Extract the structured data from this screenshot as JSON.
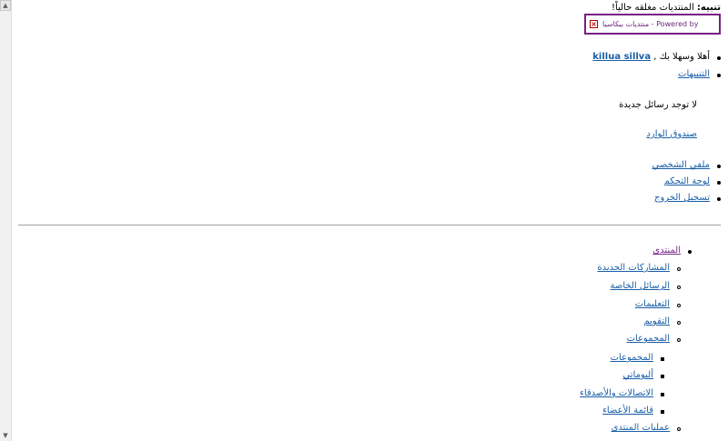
{
  "notice": {
    "label": "تنبيه:",
    "text": "المنتديات مغلقه حالياً!"
  },
  "powered": {
    "text": "منتديات بيكاسيا - Powered by"
  },
  "welcome": {
    "prefix": "أهلا وسهلا بك ,",
    "username": "killua sillva"
  },
  "alerts_link": "التنبيهات",
  "no_messages": "لا توجد رسائل جديدة",
  "inbox_link": "صندوق الوارد",
  "user_links": [
    "ملفي الشخصي",
    "لوحة التحكم",
    "تسجيل الخروج"
  ],
  "forum": {
    "title": "المنتدى",
    "items": [
      "المشاركات الجديدة",
      "الرسائل الخاصة",
      "التعليمات",
      "التقويم",
      "المجموعات"
    ],
    "sub_items": [
      "المجموعات",
      "ألبوماتي",
      "الاتصالات والأصدقاء",
      "قائمة الأعضاء"
    ],
    "last_item": "عمليات المنتدى"
  }
}
